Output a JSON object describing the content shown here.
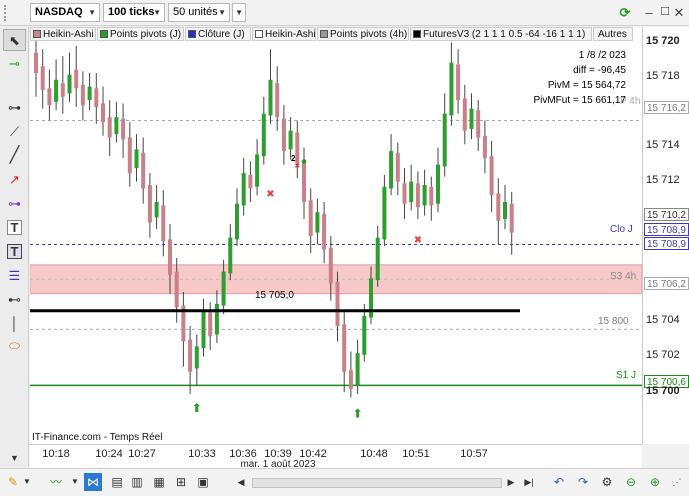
{
  "toolbar": {
    "symbol": "NASDAQ",
    "period": "100 ticks",
    "units": "50 unités"
  },
  "legend": [
    {
      "label": "Heikin-Ashi",
      "color": "#c4868a"
    },
    {
      "label": "Points pivots (J)",
      "color": "#2a9a2a"
    },
    {
      "label": "Clôture (J)",
      "color": "#2b2bc8"
    },
    {
      "label": "Heikin-Ashi",
      "color": "#ffffff"
    },
    {
      "label": "Points pivots (4h)",
      "color": "#9a9a9a"
    },
    {
      "label": "FuturesV3 (2 1 1 1 0.5 -64 -16 1 1 1)",
      "color": "#000000"
    },
    {
      "label": "Autres",
      "color": ""
    }
  ],
  "info": {
    "date": "1 /8 /2 023",
    "diff": "diff = -96,45",
    "pivm": "PivM = 15 564,72",
    "pivmfut": "PivMFut = 15 661,17"
  },
  "chart_labels": {
    "level_black": "15 705,0",
    "clo_j": "Clo J",
    "s3_4h": "S3 4h",
    "s1_j": "S1 J",
    "p4h": "P 4h",
    "level_15800": "15 800",
    "source": "IT-Finance.com - Temps Réel",
    "marker_2": "2"
  },
  "price_axis": {
    "labels": [
      "15 720",
      "15 718",
      "15 714",
      "15 712",
      "15 704",
      "15 702",
      "15 700"
    ],
    "tags": [
      "15 716,2",
      "15 710,2",
      "15 708,9",
      "15 706,2",
      "15 700,6"
    ],
    "current_price": "15 708,9"
  },
  "time_axis": {
    "labels": [
      "10:18",
      "10:24",
      "10:27",
      "10:33",
      "10:36",
      "10:39",
      "10:42",
      "10:48",
      "10:51",
      "10:57"
    ],
    "date": "mar. 1 août 2023"
  },
  "colors": {
    "bull": "#2e9e2e",
    "bear": "#c98088",
    "pivot_green": "#1a8a1a",
    "clo_blue": "#3a3ab8",
    "zone": "#f7c9c9",
    "black_line": "#000000"
  },
  "chart_data": {
    "type": "candlestick",
    "series": [
      {
        "name": "Heikin-Ashi",
        "unit": "points"
      }
    ],
    "ylim": [
      15699.8,
      15721
    ],
    "levels": {
      "p_4h": 15716.2,
      "clo_j": 15708.9,
      "s3_4h_zone": [
        15706.0,
        15707.7
      ],
      "black_line": 15705.0,
      "level_15800": 15703.9,
      "s1_j": 15700.6
    },
    "candles": [
      {
        "o": 15720.2,
        "c": 15719.0,
        "h": 15721.0,
        "l": 15717.6
      },
      {
        "o": 15719.4,
        "c": 15718.0,
        "h": 15720.4,
        "l": 15716.9
      },
      {
        "o": 15718.1,
        "c": 15717.1,
        "h": 15719.2,
        "l": 15716.2
      },
      {
        "o": 15717.3,
        "c": 15718.6,
        "h": 15719.8,
        "l": 15716.8
      },
      {
        "o": 15718.4,
        "c": 15717.6,
        "h": 15720.0,
        "l": 15716.6
      },
      {
        "o": 15717.8,
        "c": 15718.9,
        "h": 15720.2,
        "l": 15717.3
      },
      {
        "o": 15719.2,
        "c": 15718.1,
        "h": 15720.6,
        "l": 15717.0
      },
      {
        "o": 15718.3,
        "c": 15717.1,
        "h": 15719.1,
        "l": 15716.2
      },
      {
        "o": 15717.4,
        "c": 15718.2,
        "h": 15719.0,
        "l": 15716.8
      },
      {
        "o": 15718.1,
        "c": 15717.0,
        "h": 15719.0,
        "l": 15716.0
      },
      {
        "o": 15717.2,
        "c": 15716.1,
        "h": 15718.2,
        "l": 15715.3
      },
      {
        "o": 15716.4,
        "c": 15715.2,
        "h": 15717.4,
        "l": 15714.1
      },
      {
        "o": 15715.4,
        "c": 15716.4,
        "h": 15717.3,
        "l": 15714.9
      },
      {
        "o": 15716.3,
        "c": 15715.1,
        "h": 15717.2,
        "l": 15714.0
      },
      {
        "o": 15715.2,
        "c": 15713.1,
        "h": 15716.1,
        "l": 15712.3
      },
      {
        "o": 15713.4,
        "c": 15714.5,
        "h": 15715.4,
        "l": 15712.6
      },
      {
        "o": 15714.3,
        "c": 15712.2,
        "h": 15715.2,
        "l": 15711.3
      },
      {
        "o": 15712.4,
        "c": 15710.2,
        "h": 15713.1,
        "l": 15709.3
      },
      {
        "o": 15710.5,
        "c": 15711.4,
        "h": 15712.4,
        "l": 15709.8
      },
      {
        "o": 15711.2,
        "c": 15709.1,
        "h": 15712.1,
        "l": 15708.2
      },
      {
        "o": 15709.2,
        "c": 15707.1,
        "h": 15710.1,
        "l": 15706.0
      },
      {
        "o": 15707.3,
        "c": 15705.2,
        "h": 15708.1,
        "l": 15704.3
      },
      {
        "o": 15705.3,
        "c": 15703.2,
        "h": 15706.1,
        "l": 15701.7
      },
      {
        "o": 15703.3,
        "c": 15701.4,
        "h": 15704.1,
        "l": 15700.1
      },
      {
        "o": 15701.6,
        "c": 15702.9,
        "h": 15703.6,
        "l": 15700.6
      },
      {
        "o": 15702.8,
        "c": 15705.0,
        "h": 15705.7,
        "l": 15702.3
      },
      {
        "o": 15704.9,
        "c": 15703.5,
        "h": 15705.5,
        "l": 15702.7
      },
      {
        "o": 15703.6,
        "c": 15705.4,
        "h": 15706.2,
        "l": 15703.1
      },
      {
        "o": 15705.3,
        "c": 15707.3,
        "h": 15708.0,
        "l": 15704.8
      },
      {
        "o": 15707.2,
        "c": 15709.3,
        "h": 15710.1,
        "l": 15706.8
      },
      {
        "o": 15709.2,
        "c": 15711.3,
        "h": 15712.2,
        "l": 15708.8
      },
      {
        "o": 15711.2,
        "c": 15713.1,
        "h": 15714.0,
        "l": 15710.6
      },
      {
        "o": 15713.0,
        "c": 15712.2,
        "h": 15713.8,
        "l": 15711.4
      },
      {
        "o": 15712.3,
        "c": 15714.2,
        "h": 15715.1,
        "l": 15711.8
      },
      {
        "o": 15714.1,
        "c": 15716.6,
        "h": 15717.6,
        "l": 15713.6
      },
      {
        "o": 15716.5,
        "c": 15718.6,
        "h": 15720.4,
        "l": 15716.0
      },
      {
        "o": 15718.4,
        "c": 15716.4,
        "h": 15719.4,
        "l": 15715.6
      },
      {
        "o": 15716.3,
        "c": 15714.4,
        "h": 15717.1,
        "l": 15713.6
      },
      {
        "o": 15714.5,
        "c": 15715.6,
        "h": 15716.4,
        "l": 15713.9
      },
      {
        "o": 15715.5,
        "c": 15713.7,
        "h": 15716.2,
        "l": 15712.8
      },
      {
        "o": 15713.8,
        "c": 15711.4,
        "h": 15714.6,
        "l": 15710.4
      },
      {
        "o": 15711.5,
        "c": 15709.4,
        "h": 15712.2,
        "l": 15708.4
      },
      {
        "o": 15709.6,
        "c": 15710.8,
        "h": 15711.6,
        "l": 15708.9
      },
      {
        "o": 15710.7,
        "c": 15708.6,
        "h": 15711.4,
        "l": 15707.8
      },
      {
        "o": 15708.7,
        "c": 15706.6,
        "h": 15709.4,
        "l": 15705.6
      },
      {
        "o": 15706.7,
        "c": 15704.1,
        "h": 15707.3,
        "l": 15703.2
      },
      {
        "o": 15704.2,
        "c": 15701.4,
        "h": 15705.0,
        "l": 15700.2
      },
      {
        "o": 15701.5,
        "c": 15700.4,
        "h": 15702.6,
        "l": 15699.9
      },
      {
        "o": 15700.6,
        "c": 15702.5,
        "h": 15703.3,
        "l": 15700.1
      },
      {
        "o": 15702.4,
        "c": 15704.7,
        "h": 15705.4,
        "l": 15702.0
      },
      {
        "o": 15704.6,
        "c": 15706.9,
        "h": 15707.6,
        "l": 15704.2
      },
      {
        "o": 15706.8,
        "c": 15709.3,
        "h": 15710.0,
        "l": 15706.4
      },
      {
        "o": 15709.2,
        "c": 15712.3,
        "h": 15713.0,
        "l": 15708.8
      },
      {
        "o": 15712.2,
        "c": 15714.4,
        "h": 15715.4,
        "l": 15711.8
      },
      {
        "o": 15714.3,
        "c": 15712.6,
        "h": 15714.9,
        "l": 15711.8
      },
      {
        "o": 15712.5,
        "c": 15711.3,
        "h": 15713.4,
        "l": 15710.4
      },
      {
        "o": 15711.4,
        "c": 15712.6,
        "h": 15713.6,
        "l": 15710.9
      },
      {
        "o": 15712.5,
        "c": 15711.1,
        "h": 15713.2,
        "l": 15710.4
      },
      {
        "o": 15711.2,
        "c": 15712.4,
        "h": 15713.3,
        "l": 15710.6
      },
      {
        "o": 15712.3,
        "c": 15711.2,
        "h": 15712.9,
        "l": 15710.3
      },
      {
        "o": 15711.3,
        "c": 15713.6,
        "h": 15714.6,
        "l": 15710.8
      },
      {
        "o": 15713.5,
        "c": 15716.6,
        "h": 15717.8,
        "l": 15712.9
      },
      {
        "o": 15716.5,
        "c": 15719.6,
        "h": 15720.8,
        "l": 15715.9
      },
      {
        "o": 15719.5,
        "c": 15717.4,
        "h": 15720.4,
        "l": 15716.6
      },
      {
        "o": 15717.5,
        "c": 15715.6,
        "h": 15718.3,
        "l": 15714.8
      },
      {
        "o": 15715.7,
        "c": 15716.9,
        "h": 15717.8,
        "l": 15715.1
      },
      {
        "o": 15716.8,
        "c": 15715.2,
        "h": 15717.4,
        "l": 15714.4
      },
      {
        "o": 15715.3,
        "c": 15714.0,
        "h": 15716.2,
        "l": 15713.1
      },
      {
        "o": 15714.1,
        "c": 15711.8,
        "h": 15715.0,
        "l": 15710.8
      },
      {
        "o": 15711.9,
        "c": 15710.3,
        "h": 15712.8,
        "l": 15708.9
      },
      {
        "o": 15710.4,
        "c": 15711.4,
        "h": 15712.4,
        "l": 15709.8
      },
      {
        "o": 15711.3,
        "c": 15709.6,
        "h": 15712.0,
        "l": 15708.3
      }
    ]
  }
}
